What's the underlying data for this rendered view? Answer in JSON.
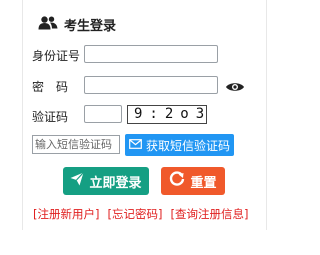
{
  "header": {
    "title": "考生登录",
    "icon": "users-icon"
  },
  "form": {
    "id_label": "身份证号",
    "id_value": "",
    "password_label": "密　码",
    "password_value": "",
    "captcha_label": "验证码",
    "captcha_value": "",
    "captcha_image_text": "9:2o3",
    "sms_placeholder": "输入短信验证码",
    "sms_button": "获取短信验证码"
  },
  "actions": {
    "login": "立即登录",
    "reset": "重置"
  },
  "links": [
    "[注册新用户]",
    "[忘记密码]",
    "[查询注册信息]"
  ],
  "colors": {
    "login": "#159f83",
    "reset": "#f0592b",
    "sms": "#2196f3",
    "link": "#e02020"
  }
}
